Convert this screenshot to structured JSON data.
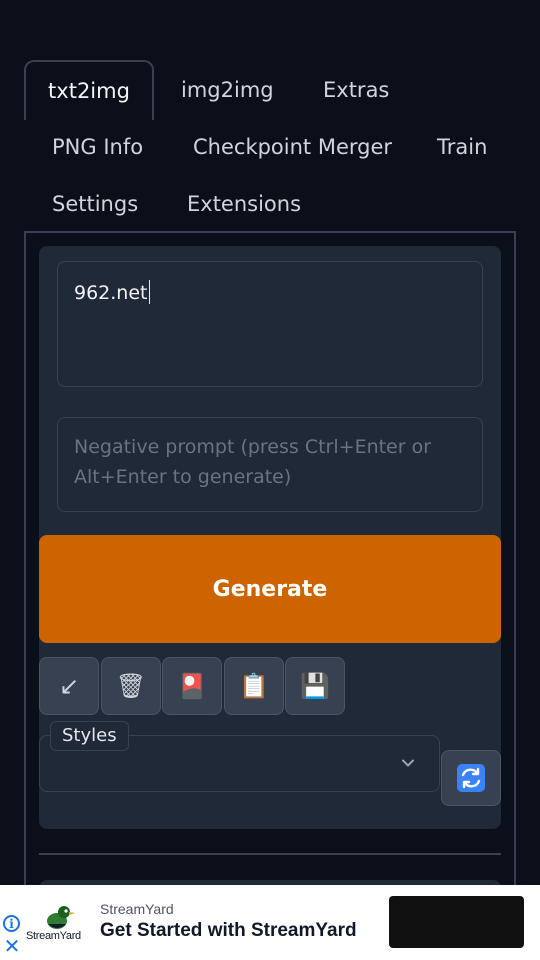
{
  "tabs": [
    {
      "label": "txt2img",
      "active": true
    },
    {
      "label": "img2img"
    },
    {
      "label": "Extras"
    },
    {
      "label": "PNG Info"
    },
    {
      "label": "Checkpoint Merger"
    },
    {
      "label": "Train"
    },
    {
      "label": "Settings"
    },
    {
      "label": "Extensions"
    }
  ],
  "prompt": {
    "value": "962.net"
  },
  "negative_prompt": {
    "placeholder": "Negative prompt (press Ctrl+Enter or Alt+Enter to generate)"
  },
  "generate_button": {
    "label": "Generate",
    "color": "#ce6400"
  },
  "tool_buttons": [
    {
      "icon": "arrow-down-left-icon",
      "glyph": "↙"
    },
    {
      "icon": "trash-icon",
      "glyph": "🗑"
    },
    {
      "icon": "red-card-icon",
      "glyph": "🎴"
    },
    {
      "icon": "clipboard-icon",
      "glyph": "📋"
    },
    {
      "icon": "floppy-disk-icon",
      "glyph": "💾"
    }
  ],
  "styles": {
    "label": "Styles",
    "value": ""
  },
  "refresh_icon": "refresh-icon",
  "ad": {
    "brand": "StreamYard",
    "logo_text": "StreamYard",
    "headline": "Get Started with StreamYard"
  }
}
